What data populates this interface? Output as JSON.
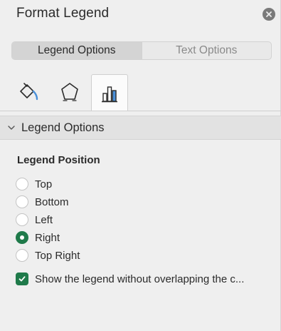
{
  "pane": {
    "title": "Format Legend",
    "close_icon": "close-icon"
  },
  "top_tabs": [
    {
      "label": "Legend Options",
      "selected": true
    },
    {
      "label": "Text Options",
      "selected": false
    }
  ],
  "icon_tabs": [
    {
      "icon": "fill-line-icon",
      "selected": false
    },
    {
      "icon": "effects-pentagon-icon",
      "selected": false
    },
    {
      "icon": "legend-options-bar-chart-icon",
      "selected": true
    }
  ],
  "section": {
    "label": "Legend Options",
    "expanded": true
  },
  "legend_position": {
    "heading": "Legend Position",
    "options": [
      {
        "label": "Top",
        "checked": false
      },
      {
        "label": "Bottom",
        "checked": false
      },
      {
        "label": "Left",
        "checked": false
      },
      {
        "label": "Right",
        "checked": true
      },
      {
        "label": "Top Right",
        "checked": false
      }
    ]
  },
  "overlap_checkbox": {
    "label": "Show the legend without overlapping the c...",
    "checked": true
  },
  "colors": {
    "accent": "#1f7a4a",
    "icon_blue": "#4a90d9"
  }
}
